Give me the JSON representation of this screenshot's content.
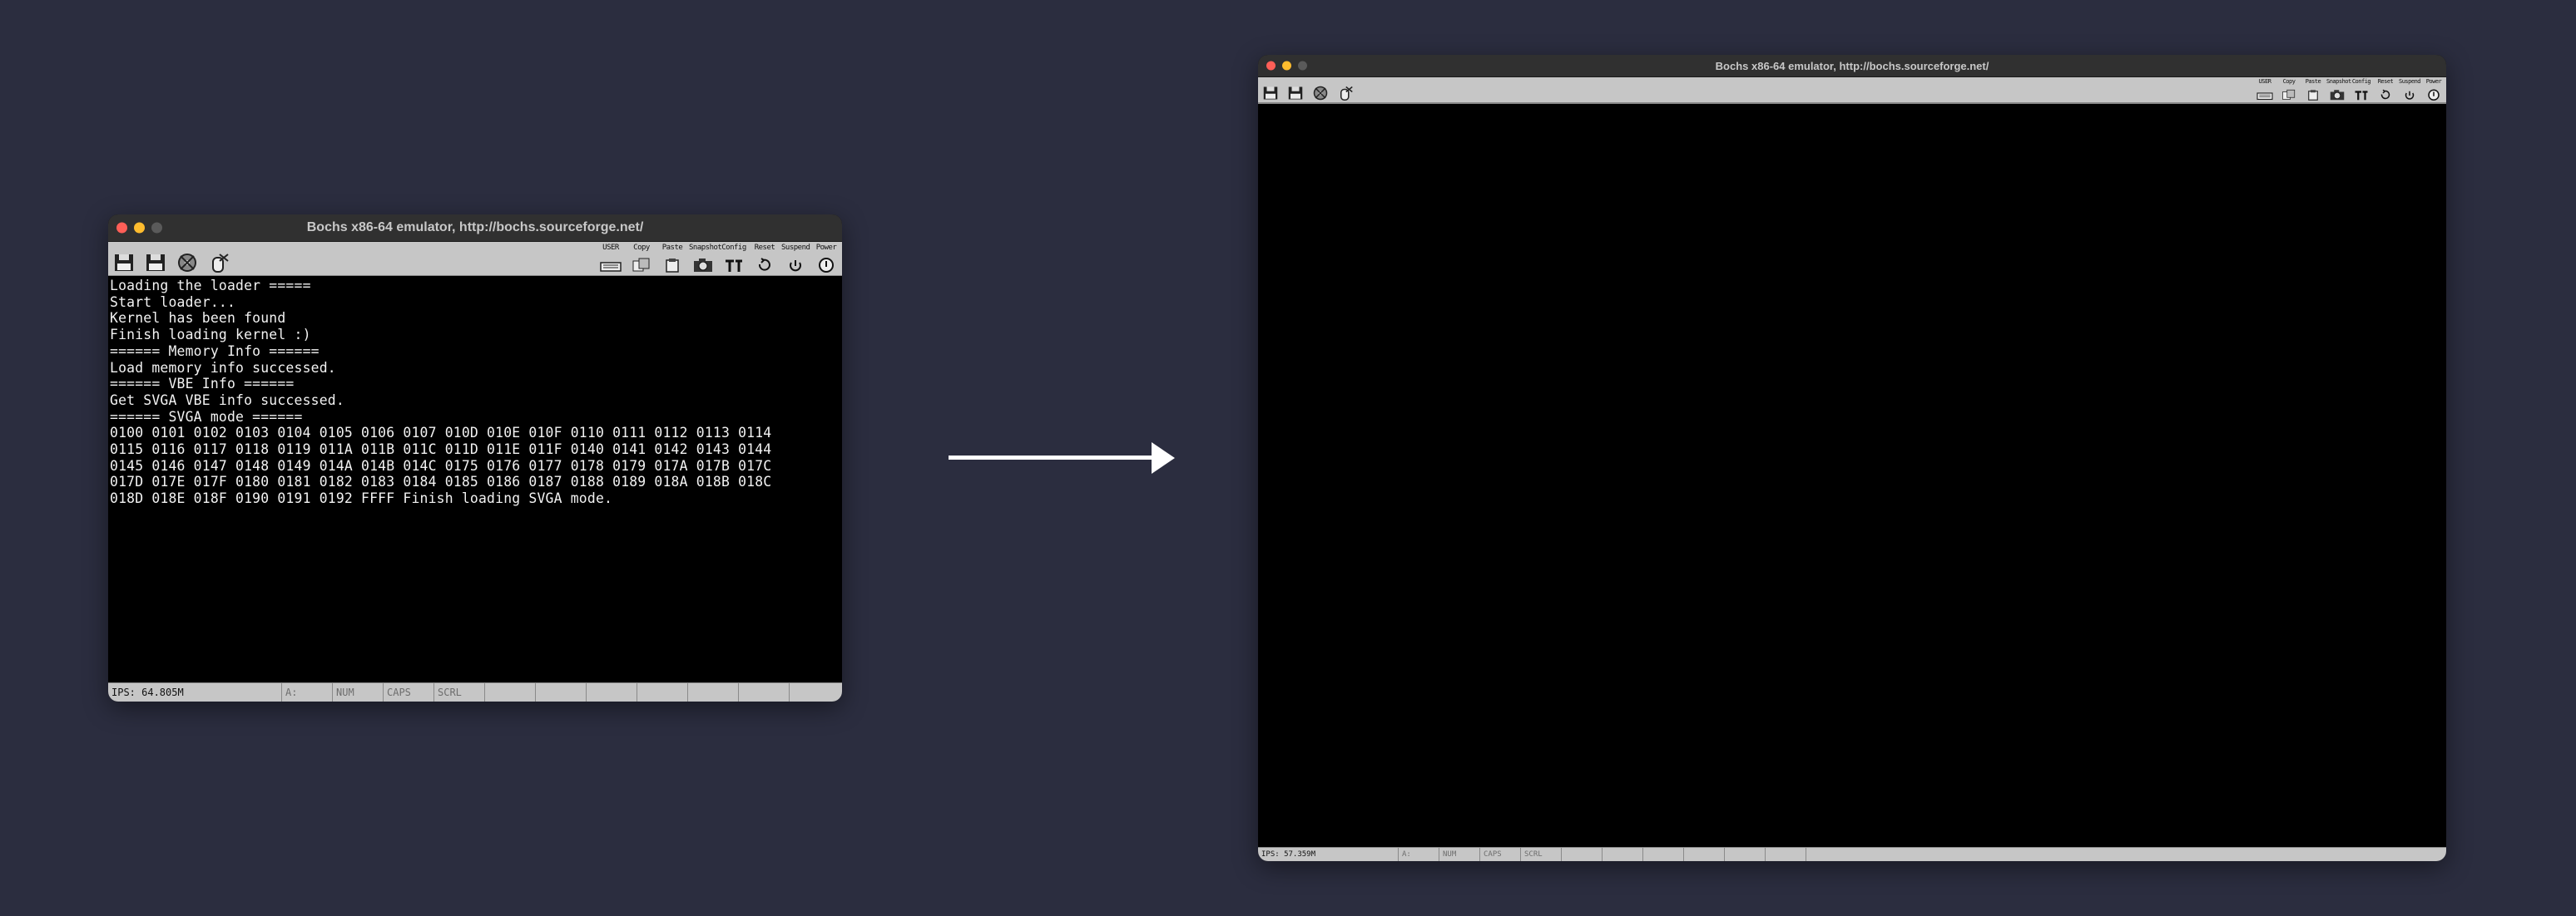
{
  "left_window": {
    "title": "Bochs x86-64 emulator, http://bochs.sourceforge.net/",
    "toolbar_right_labels": [
      "USER",
      "Copy",
      "Paste",
      "Snapshot",
      "Config",
      "Reset",
      "Suspend",
      "Power"
    ],
    "console_lines": [
      "Loading the loader =====",
      "Start loader...",
      "Kernel has been found",
      "Finish loading kernel :)",
      "====== Memory Info ======",
      "Load memory info successed.",
      "====== VBE Info ======",
      "Get SVGA VBE info successed.",
      "====== SVGA mode ======",
      "0100 0101 0102 0103 0104 0105 0106 0107 010D 010E 010F 0110 0111 0112 0113 0114",
      "0115 0116 0117 0118 0119 011A 011B 011C 011D 011E 011F 0140 0141 0142 0143 0144",
      "0145 0146 0147 0148 0149 014A 014B 014C 0175 0176 0177 0178 0179 017A 017B 017C",
      "017D 017E 017F 0180 0181 0182 0183 0184 0185 0186 0187 0188 0189 018A 018B 018C",
      "018D 018E 018F 0190 0191 0192 FFFF Finish loading SVGA mode."
    ],
    "status": {
      "ips": "IPS: 64.805M",
      "drive": "A:",
      "num": "NUM",
      "caps": "CAPS",
      "scrl": "SCRL"
    }
  },
  "right_window": {
    "title": "Bochs x86-64 emulator, http://bochs.sourceforge.net/",
    "toolbar_right_labels": [
      "USER",
      "Copy",
      "Paste",
      "Snapshot",
      "Config",
      "Reset",
      "Suspend",
      "Power"
    ],
    "status": {
      "ips": "IPS: 57.359M",
      "drive": "A:",
      "num": "NUM",
      "caps": "CAPS",
      "scrl": "SCRL"
    }
  },
  "colors": {
    "background": "#2b2d3f",
    "titlebar": "#303030",
    "toolbar": "#c6c6c6",
    "screen": "#000000",
    "console_text": "#f2f2f2",
    "close": "#ff5f57",
    "minimize": "#febc2e"
  }
}
